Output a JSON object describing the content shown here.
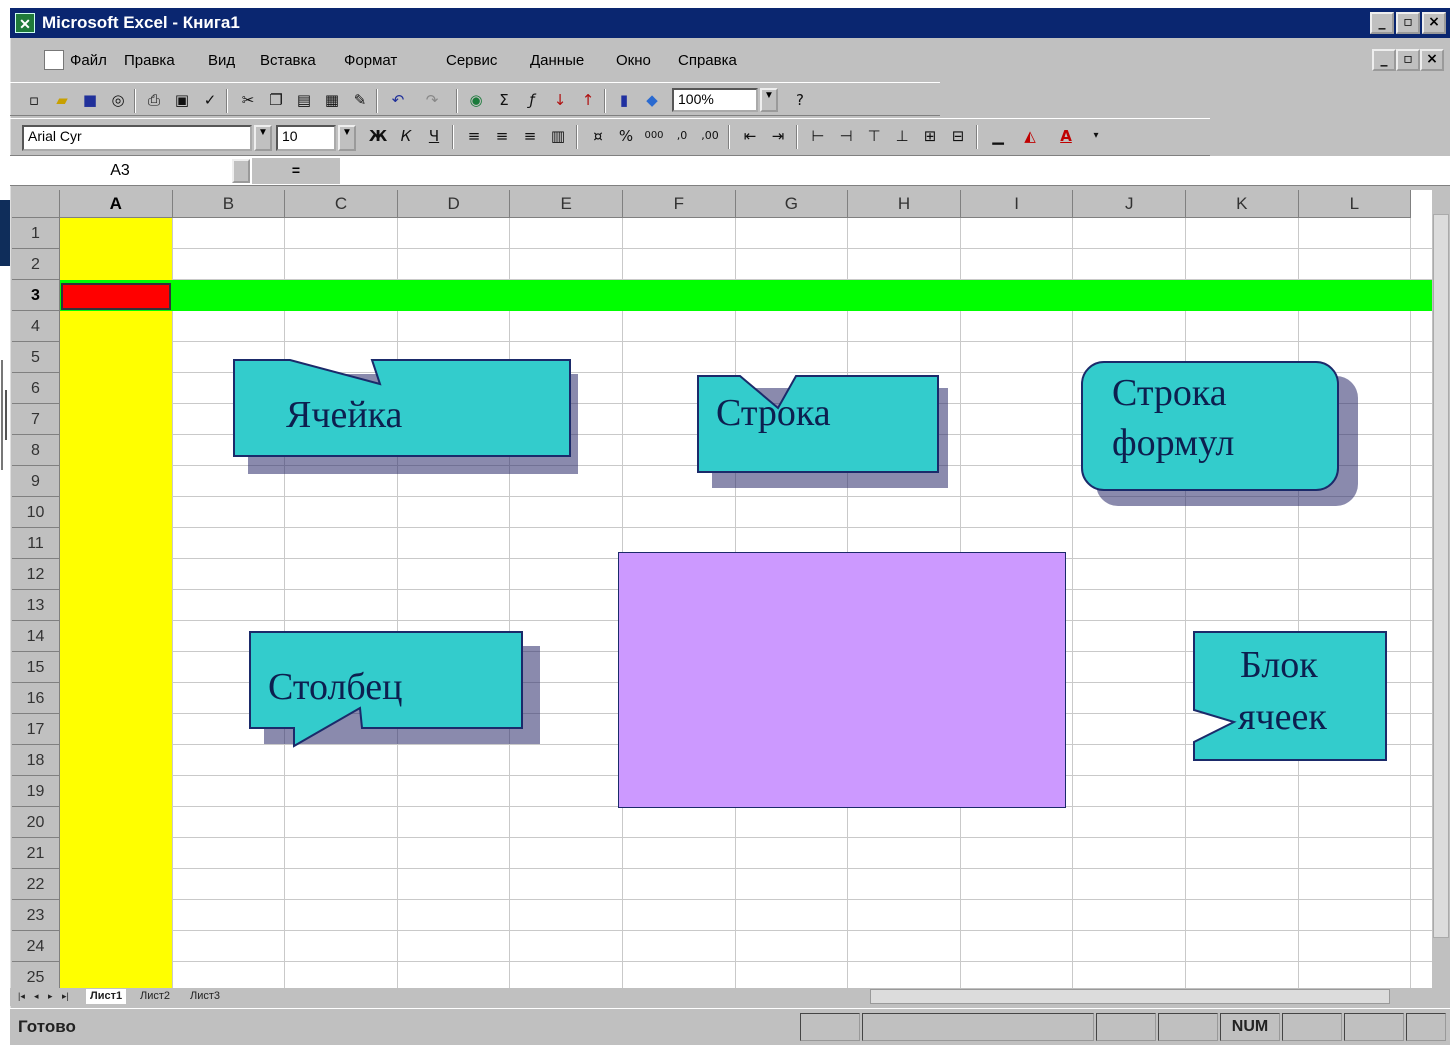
{
  "window": {
    "title": "Microsoft Excel - Книга1"
  },
  "menu": [
    "Файл",
    "Правка",
    "Вид",
    "Вставка",
    "Формат",
    "Сервис",
    "Данные",
    "Окно",
    "Справка"
  ],
  "toolbar": {
    "zoom": "100%",
    "font_name": "Arial Cyr",
    "font_size": "10"
  },
  "formula_bar": {
    "name_box": "A3",
    "equals": "="
  },
  "columns": [
    "A",
    "B",
    "C",
    "D",
    "E",
    "F",
    "G",
    "H",
    "I",
    "J",
    "K",
    "L"
  ],
  "rows": [
    "1",
    "2",
    "3",
    "4",
    "5",
    "6",
    "7",
    "8",
    "9",
    "10",
    "11",
    "12",
    "13",
    "14",
    "15",
    "16",
    "17",
    "18",
    "19",
    "20",
    "21",
    "22",
    "23",
    "24",
    "25"
  ],
  "sheet_tabs": [
    "Лист1",
    "Лист2",
    "Лист3"
  ],
  "status": {
    "text": "Готово",
    "num": "NUM"
  },
  "colors": {
    "column_a": "#ffff00",
    "row_3": "#00ff00",
    "active_cell": "#ff0000",
    "block": "#cc99ff",
    "callout": "#33cccc",
    "titlebar": "#0a2670"
  },
  "callouts": {
    "cell": "Ячейка",
    "row": "Строка",
    "formula_bar_line1": "Строка",
    "formula_bar_line2": "формул",
    "column": "Столбец",
    "block_line1": "Блок",
    "block_line2": "ячеек"
  }
}
